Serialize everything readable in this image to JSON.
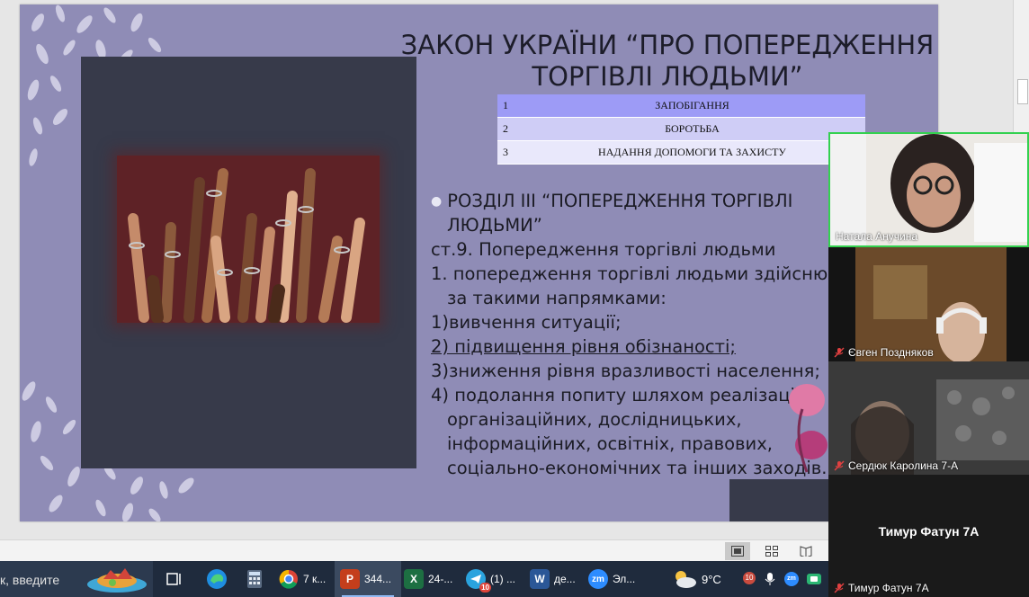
{
  "slide": {
    "title_line1": "ЗАКОН УКРАЇНИ “ПРО ПОПЕРЕДЖЕННЯ",
    "title_line2": "ТОРГІВЛІ ЛЮДЬМИ”",
    "table": [
      {
        "num": "1",
        "text": "ЗАПОБІГАННЯ"
      },
      {
        "num": "2",
        "text": "БОРОТЬБА"
      },
      {
        "num": "3",
        "text": "НАДАННЯ ДОПОМОГИ ТА ЗАХИСТУ"
      }
    ],
    "lines": [
      "РОЗДІЛ ІІІ “ПОПЕРЕДЖЕННЯ ТОРГІВЛІ",
      "ЛЮДЬМИ”",
      "ст.9. Попередження торгівлі людьми",
      "1. попередження торгівлі людьми здійснюється",
      "за такими напрямками:",
      "1)вивчення ситуації;",
      "2) підвищення рівня обізнаності;",
      "3)зниження рівня вразливості населення;",
      "4) подолання попиту шляхом реалізації",
      "організаційних, дослідницьких,",
      "інформаційних, освітніх, правових,",
      "соціально-економічних та інших заходів."
    ]
  },
  "taskbar": {
    "search_text": "к, введите",
    "apps": [
      {
        "label": "7 к...",
        "icon": "chrome-icon"
      },
      {
        "label": "344...",
        "icon": "powerpoint-icon"
      },
      {
        "label": "24-...",
        "icon": "excel-icon"
      },
      {
        "label": "(1) ...",
        "icon": "telegram-icon",
        "badge": "10"
      },
      {
        "label": "де...",
        "icon": "word-icon"
      },
      {
        "label": "Эл...",
        "icon": "zoom-icon"
      }
    ],
    "temperature": "9°C",
    "tray_badge": "10"
  },
  "zoom": {
    "participants": [
      {
        "name": "Натала Анучина",
        "muted": false
      },
      {
        "name": "Євген Поздняков",
        "muted": true
      },
      {
        "name": "Сердюк Каролина 7-А",
        "muted": true
      },
      {
        "name": "Тимур Фатун 7А",
        "muted": true
      }
    ],
    "center_name": "Тимур Фатун 7А"
  },
  "colors": {
    "slide_bg": "#8f8cb6",
    "panel_bg": "#373a4a",
    "taskbar_bg": "#1f2b3d"
  }
}
